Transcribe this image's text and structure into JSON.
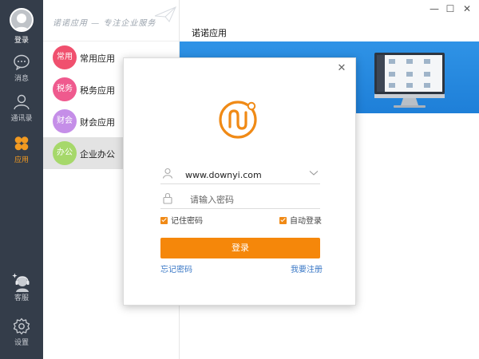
{
  "rail": {
    "items": [
      {
        "label": "登录"
      },
      {
        "label": "消息"
      },
      {
        "label": "通讯录"
      },
      {
        "label": "应用"
      },
      {
        "label": "客服"
      },
      {
        "label": "设置"
      }
    ],
    "active_color": "#f29a21"
  },
  "categories": {
    "slogan": "诺诺应用 — 专注企业服务",
    "items": [
      {
        "badge": "常用",
        "name": "常用应用",
        "color": "#f0506e"
      },
      {
        "badge": "税务",
        "name": "税务应用",
        "color": "#ef5a8e"
      },
      {
        "badge": "财会",
        "name": "财会应用",
        "color": "#c58ee8"
      },
      {
        "badge": "办公",
        "name": "企业办公",
        "color": "#a6d86a",
        "active": true
      }
    ]
  },
  "main": {
    "title": "诺诺应用"
  },
  "window": {
    "minimize": "—",
    "maximize": "☐",
    "close": "✕"
  },
  "login": {
    "close": "✕",
    "username": "www.downyi.com",
    "password_placeholder": "请输入密码",
    "remember_password": "记住密码",
    "auto_login": "自动登录",
    "login_button": "登录",
    "forgot_password": "忘记密码",
    "register": "我要注册",
    "accent": "#f5870a"
  }
}
